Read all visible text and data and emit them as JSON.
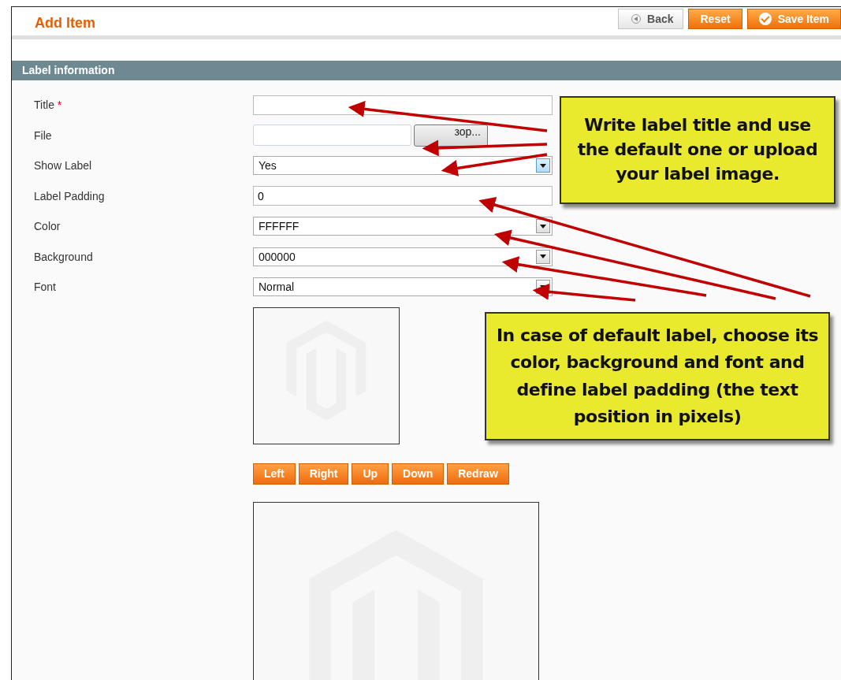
{
  "page": {
    "title": "Add Item"
  },
  "header_buttons": [
    {
      "label": "Back",
      "kind": "back"
    },
    {
      "label": "Reset",
      "kind": "plain"
    },
    {
      "label": "Save Item",
      "kind": "save"
    }
  ],
  "section": {
    "title": "Label information"
  },
  "fields": [
    {
      "label": "Title",
      "required_mark": "*",
      "kind": "text"
    },
    {
      "label": "File",
      "kind": "file",
      "button": "зор..."
    },
    {
      "label": "Show Label",
      "kind": "select",
      "value": "Yes",
      "focused": true
    },
    {
      "label": "Label Padding",
      "kind": "text",
      "value": "0"
    },
    {
      "label": "Color",
      "kind": "select",
      "value": "FFFFFF",
      "focused": false
    },
    {
      "label": "Background",
      "kind": "select",
      "value": "000000",
      "focused": false
    },
    {
      "label": "Font",
      "kind": "select",
      "value": "Normal",
      "focused": false
    }
  ],
  "move_buttons": [
    "Left",
    "Right",
    "Up",
    "Down",
    "Redraw"
  ],
  "callouts": [
    {
      "text": "Write label title and use the default one or upload your label image."
    },
    {
      "text": "In case of default label, choose its color, background and font and define label padding (the text position in pixels)"
    }
  ]
}
